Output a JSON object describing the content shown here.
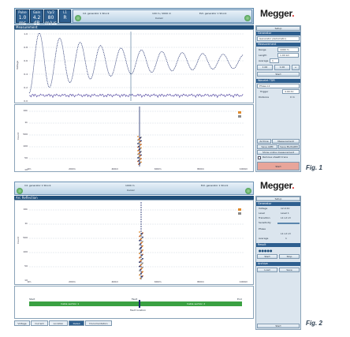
{
  "brand": {
    "logo_text": "Megger",
    "logo_dot": "."
  },
  "fig1": {
    "caption": "Fig. 1",
    "toolbar_buttons": [
      {
        "label": "Pulse",
        "value": "1.0 ms"
      },
      {
        "label": "Gain",
        "value": "4.2 dB"
      },
      {
        "label": "Vp/2",
        "value": "80 m/us"
      }
    ],
    "phase_button": {
      "label": "L1",
      "value": "R"
    },
    "status_left": "Int. generator 1 Shock",
    "status_mid_1": "100 m / 2000 m",
    "status_mid_2": "Cursor",
    "status_right": "Ext. generator 1 Shock",
    "panel_title": "Measurement",
    "side": {
      "top": "Setup",
      "section1": "Generator",
      "dropdown1": "Generator (Automatic)",
      "section2": "Measurement",
      "range_label": "Range",
      "range_value": "1000 m",
      "length_label": "Length",
      "length_value": "1.00 km",
      "average_label": "Average",
      "average_value": "1",
      "steppers": [
        "1.00",
        "1.00"
      ],
      "start_label": "Start",
      "section3": "Wavelet TDR",
      "phase_dropdown": "Phase L1",
      "trigger_label": "Trigger",
      "trigger_value": "4.00 kV",
      "dist_label": "Distance",
      "dist_value": "0 m",
      "btn_row1": [
        "Archive",
        "Measurement"
      ],
      "btn_row2": [
        "Save ARM",
        "Save MultiARM"
      ],
      "btn_row3": "Show online measurement",
      "check_label": "Remove sheath trace",
      "action": "Start"
    }
  },
  "fig2": {
    "caption": "Fig. 2",
    "status_left": "Int. generator 1 Shock",
    "status_mid_1": "1000 m",
    "status_mid_2": "Cursor",
    "status_right": "Ext. generator 1 Shock",
    "panel_title": "Arc Reflection",
    "side": {
      "top": "Setup",
      "section1": "Generator",
      "voltage_label": "Voltage",
      "voltage_value": "12.0 kV",
      "level_label": "Level",
      "level_value": "Level 1",
      "trans_label": "Transition",
      "trans_value": "L1 L2 L3",
      "sens_label": "Sensitivity",
      "phase_label": "Phase",
      "phase_value": "L1 L2 L3",
      "avg_label": "Average",
      "avg_value": "1",
      "section2": "Result",
      "dots": "Display",
      "btn_row": [
        "Start",
        "Stop"
      ],
      "section3": "Archive",
      "archive_btns": [
        "Load",
        "Save"
      ],
      "bottom": "Start"
    },
    "tabs": [
      "Voltage",
      "Current",
      "Location",
      "Detail",
      "Documentation"
    ],
    "bar_labels": {
      "left": "Start",
      "mid": "Fault",
      "right": "End"
    },
    "bar_text_left": "Cable section 1",
    "bar_text_right": "Cable section 2",
    "bar_under": "Fault location"
  },
  "axes": {
    "top_y": [
      "1.0",
      "0.8",
      "0.6",
      "0.4",
      "0.2",
      "0.0"
    ],
    "scatter_y": [
      "10k",
      "1k",
      "500",
      "100",
      "50",
      "10"
    ],
    "scatter_x": [
      "0m",
      "200m",
      "400m",
      "600m",
      "800m",
      "1000m"
    ],
    "y_title_top": "Voltage",
    "y_title_scatter": "Count"
  },
  "colors": {
    "accent": "#1f4e79",
    "green_bar": "#3aa142",
    "logo_red": "#d6211d",
    "action_red": "#e8a59a"
  }
}
